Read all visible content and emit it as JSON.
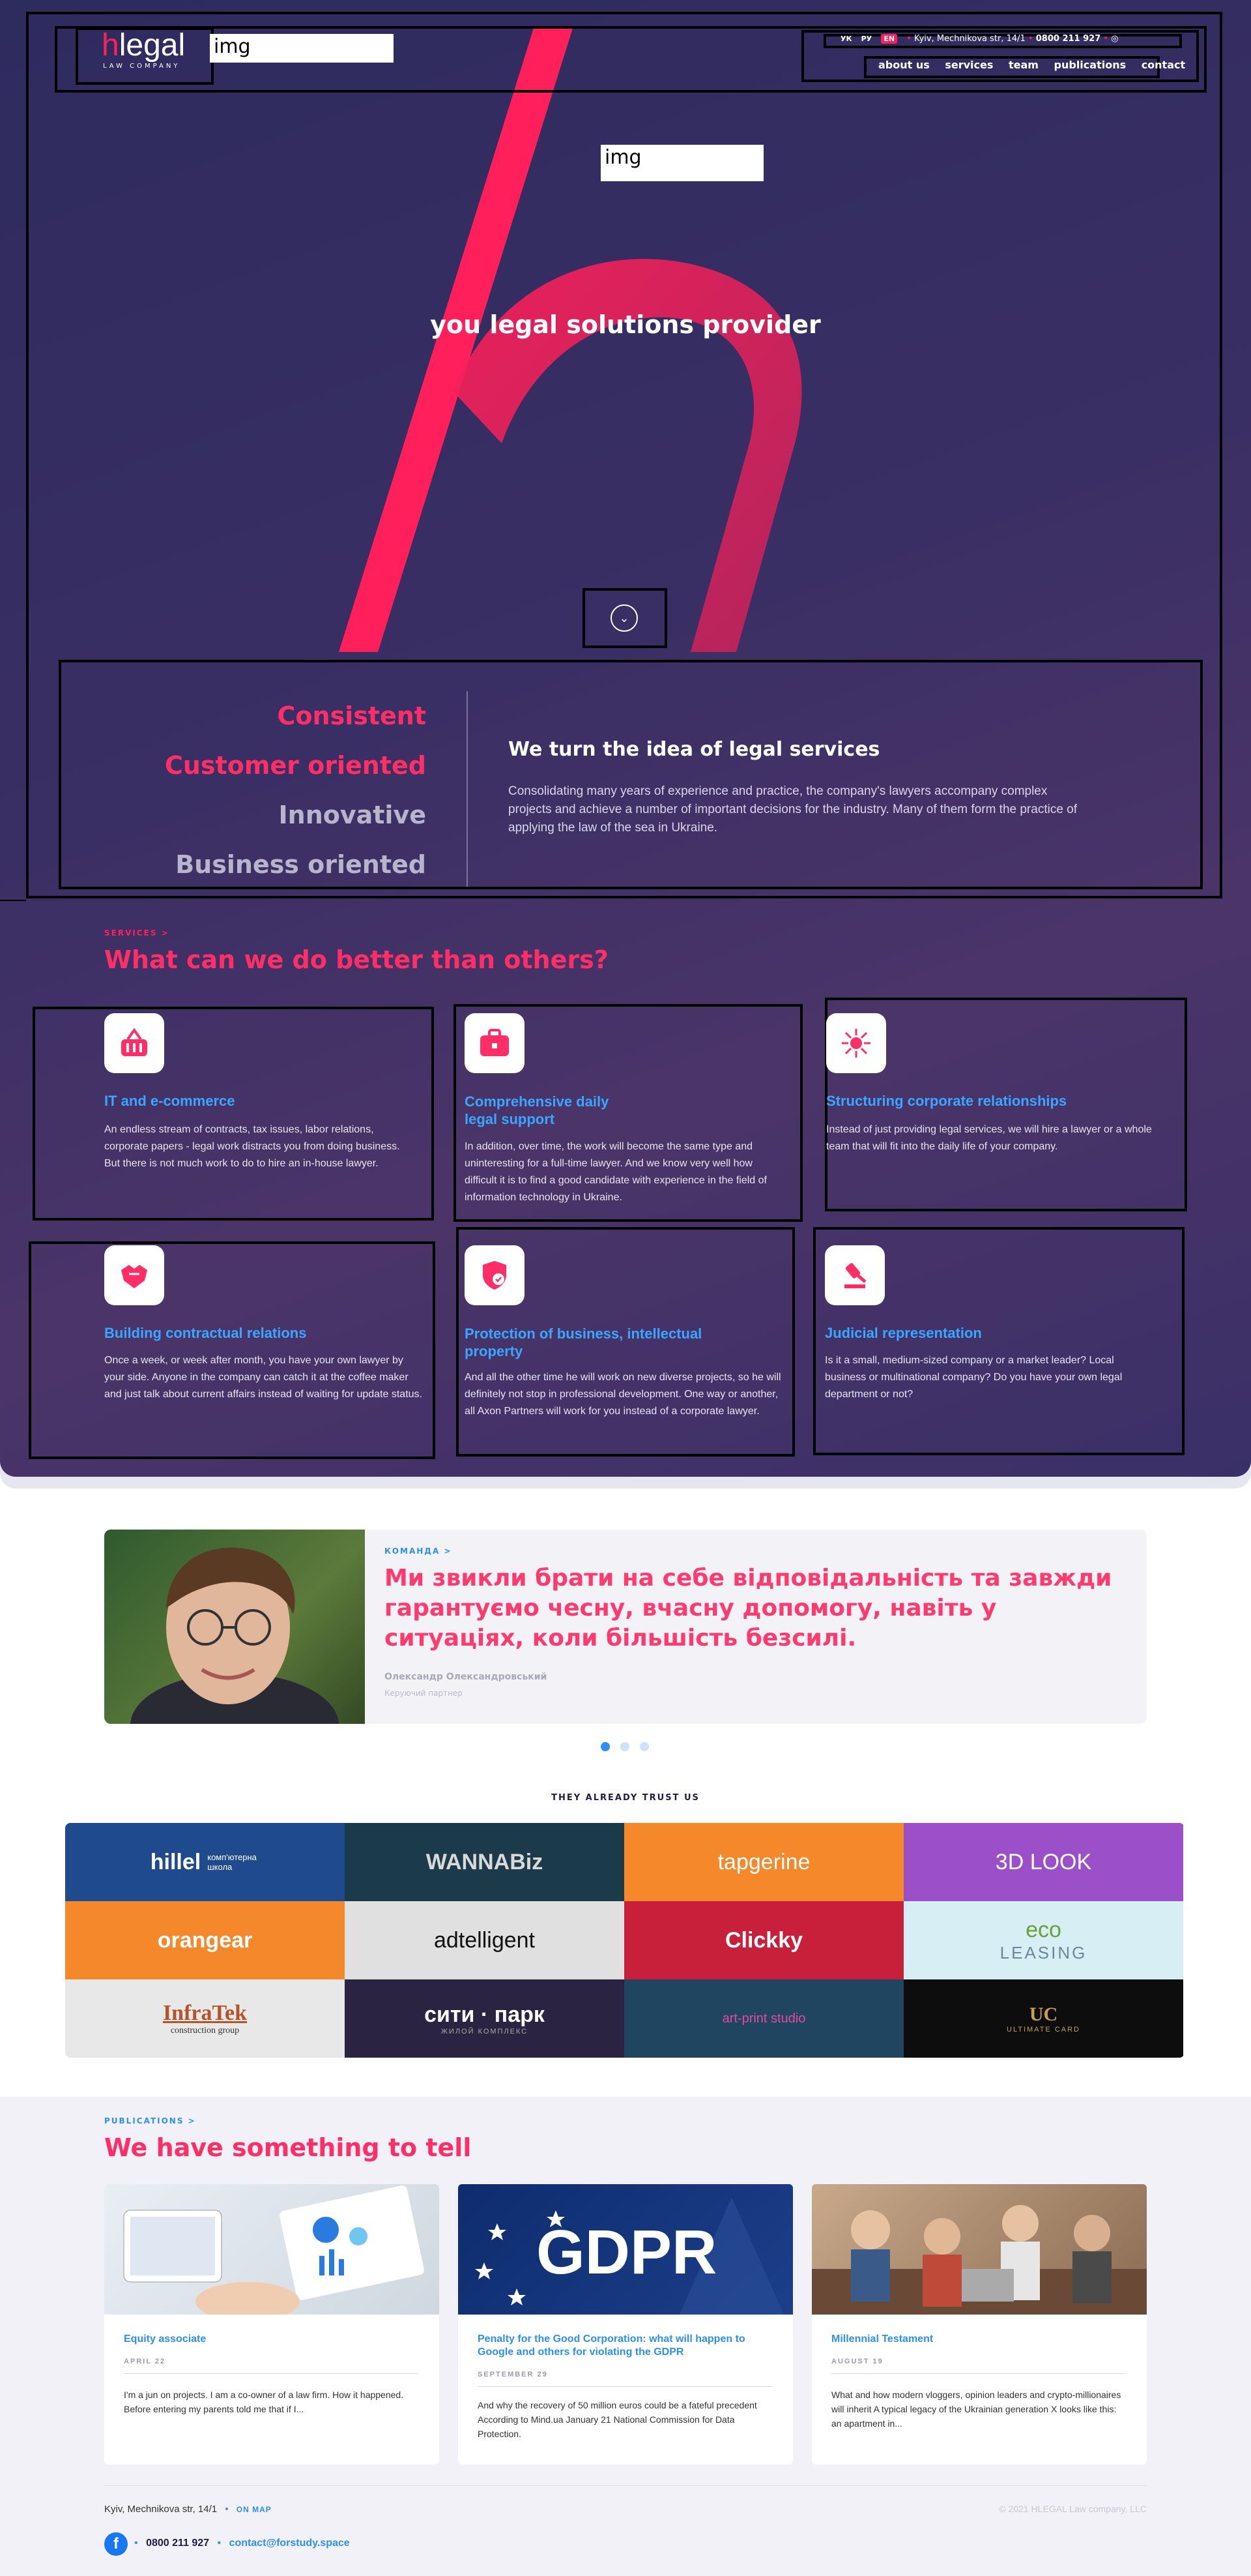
{
  "header": {
    "logo_h": "h",
    "logo_text": "legal",
    "logo_sub": "LAW COMPANY",
    "img_placeholder_1": "img",
    "img_placeholder_2": "img",
    "langs": [
      "УК",
      "РУ",
      "EN"
    ],
    "address": "Kyiv, Mechnikova str, 14/1",
    "phone": "0800 211 927",
    "nav": [
      "about us",
      "services",
      "team",
      "publications",
      "contact"
    ]
  },
  "hero": {
    "tagline": "you legal solutions provider",
    "scroll_icon": "chevron-down-icon"
  },
  "values": {
    "items": [
      "Consistent",
      "Customer oriented",
      "Innovative",
      "Business oriented"
    ],
    "heading": "We turn the idea of legal services",
    "text": "Consolidating many years of experience and practice, the company's lawyers accompany complex projects and achieve a number of important decisions for the industry. Many of them form the practice of applying the law of the sea in Ukraine."
  },
  "services": {
    "kicker": "SERVICES >",
    "heading": "What can we do better than others?",
    "items": [
      {
        "icon": "shopping-basket-icon",
        "title": "IT and e-commerce",
        "text": "An endless stream of contracts, tax issues, labor relations, corporate papers - legal work distracts you from doing business. But there is not much work to do to hire an in-house lawyer."
      },
      {
        "icon": "briefcase-icon",
        "title": "Comprehensive daily legal support",
        "text": "In addition, over time, the work will become the same type and uninteresting for a full-time lawyer. And we know very well how difficult it is to find a good candidate with experience in the field of information technology in Ukraine."
      },
      {
        "icon": "network-icon",
        "title": "Structuring corporate relationships",
        "text": "Instead of just providing legal services, we will hire a lawyer or a whole team that will fit into the daily life of your company."
      },
      {
        "icon": "handshake-icon",
        "title": "Building contractual relations",
        "text": "Once a week, or week after month, you have your own lawyer by your side. Anyone in the company can catch it at the coffee maker and just talk about current affairs instead of waiting for update status."
      },
      {
        "icon": "shield-check-icon",
        "title": "Protection of business, intellectual property",
        "text": "And all the other time he will work on new diverse projects, so he will definitely not stop in professional development. One way or another, all Axon Partners will work for you instead of a corporate lawyer."
      },
      {
        "icon": "gavel-icon",
        "title": "Judicial representation",
        "text": "Is it a small, medium-sized company or a market leader? Local business or multinational company? Do you have your own legal department or not?"
      }
    ]
  },
  "team": {
    "kicker": "КОМАНДА >",
    "quote": "Ми звикли брати на себе відповідальність та завжди гарантуємо чесну, вчасну допомогу, навіть у ситуаціях, коли більшість безсилі.",
    "name": "Олександр Олександровський",
    "role": "Керуючий партнер"
  },
  "trust": {
    "heading": "THEY ALREADY TRUST US",
    "logos": [
      {
        "name": "hillel",
        "sub": "комп'ютерна школа",
        "bg": "#1f4b8e",
        "color": "#ffffff"
      },
      {
        "name": "WANNABiz",
        "sub": "",
        "bg": "#1b3a4a",
        "color": "#d9d9d9"
      },
      {
        "name": "tapgerine",
        "sub": "",
        "bg": "#f5882a",
        "color": "#ffffff"
      },
      {
        "name": "3D LOOK",
        "sub": "",
        "bg": "#9b4fc9",
        "color": "#ffffff"
      },
      {
        "name": "orangear",
        "sub": "",
        "bg": "#f5882a",
        "color": "#ffffff"
      },
      {
        "name": "adtelligent",
        "sub": "",
        "bg": "#e0e0e0",
        "color": "#111111"
      },
      {
        "name": "Clickky",
        "sub": "",
        "bg": "#c8203a",
        "color": "#ffffff"
      },
      {
        "name": "eco",
        "sub": "LEASING",
        "bg": "#d7eef5",
        "color": "#6aa03a"
      },
      {
        "name": "InfraTek",
        "sub": "construction group",
        "bg": "#e8e8e8",
        "color": "#b3542a"
      },
      {
        "name": "сити · парк",
        "sub": "ЖИЛОЙ КОМПЛЕКС",
        "bg": "#2a2442",
        "color": "#ffffff"
      },
      {
        "name": "art-print studio",
        "sub": "",
        "bg": "#1f4560",
        "color": "#e24b9e"
      },
      {
        "name": "UC",
        "sub": "ULTIMATE CARD",
        "bg": "#0d0d0d",
        "color": "#c8a04a"
      }
    ]
  },
  "publications": {
    "kicker": "PUBLICATIONS >",
    "heading": "We have something to tell",
    "items": [
      {
        "title": "Equity associate",
        "date": "APRIL 22",
        "text": "I'm a jun on projects. I am a co-owner of a law firm. How it happened. Before entering my parents told me that if I..."
      },
      {
        "title": "Penalty for the Good Corporation: what will happen to Google and others for violating the GDPR",
        "date": "SEPTEMBER 29",
        "text": "And why the recovery of 50 million euros could be a fateful precedent According to Mind.ua January 21 National Commission for Data Protection."
      },
      {
        "title": "Millennial Testament",
        "date": "AUGUST 19",
        "text": "What and how modern vloggers, opinion leaders and crypto-millionaires will inherit A typical legacy of the Ukrainian generation X looks like this: an apartment in..."
      }
    ],
    "gdpr_label": "GDPR"
  },
  "footer": {
    "address": "Kyiv, Mechnikova str, 14/1",
    "map_link": "ON MAP",
    "copyright": "© 2021 HLEGAL Law company, LLC",
    "phone": "0800 211 927",
    "email": "contact@forstudy.space"
  },
  "colors": {
    "accent": "#ff1f5a",
    "link": "#3aa6ff",
    "hero_bg": "#2e2b5f"
  }
}
